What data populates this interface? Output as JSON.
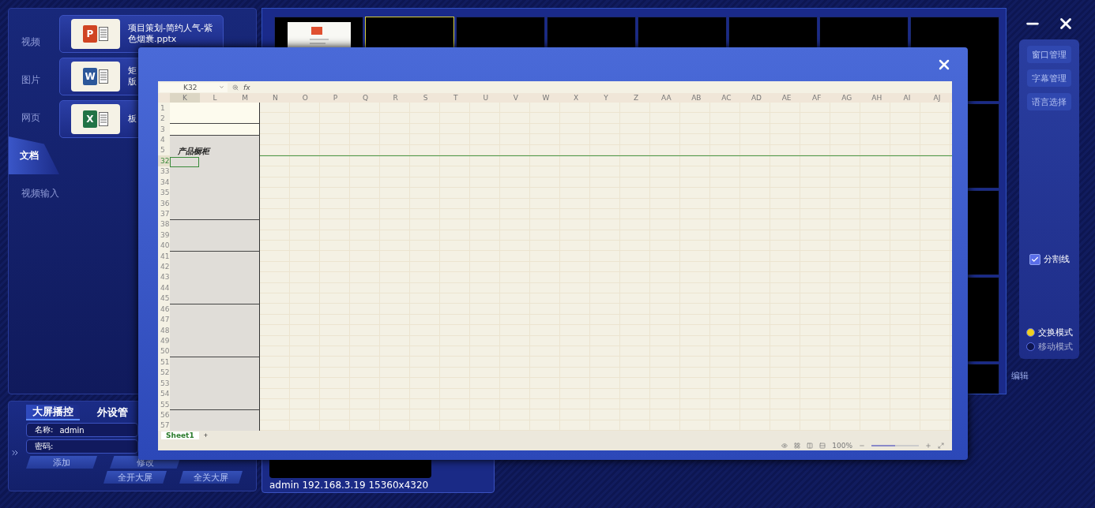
{
  "sidebar": {
    "items": [
      {
        "label": "视频",
        "selected": false
      },
      {
        "label": "图片",
        "selected": false
      },
      {
        "label": "网页",
        "selected": false
      },
      {
        "label": "文档",
        "selected": true
      },
      {
        "label": "视频输入",
        "selected": false
      }
    ]
  },
  "files": [
    {
      "kind": "ppt",
      "letter": "P",
      "lines": [
        "项目策划-简约人气-紫",
        "色烟囊.pptx"
      ]
    },
    {
      "kind": "word",
      "letter": "W",
      "lines": [
        "矩",
        "版"
      ]
    },
    {
      "kind": "excel",
      "letter": "X",
      "lines": [
        "板"
      ]
    }
  ],
  "video_wall": {
    "tiles": [
      {
        "kind": "document",
        "selected": false
      },
      {
        "kind": "empty",
        "selected": true
      },
      {
        "kind": "empty",
        "selected": false
      },
      {
        "kind": "empty",
        "selected": false
      },
      {
        "kind": "empty",
        "selected": false
      },
      {
        "kind": "empty",
        "selected": false
      },
      {
        "kind": "empty",
        "selected": false
      },
      {
        "kind": "empty",
        "selected": false
      }
    ]
  },
  "control_panel": {
    "buttons": [
      "窗口管理",
      "字幕管理",
      "语言选择"
    ],
    "divider": {
      "label": "分割线",
      "checked": true
    },
    "modes": [
      {
        "label": "交换模式",
        "selected": true
      },
      {
        "label": "移动模式",
        "selected": false
      }
    ],
    "footer": "编辑"
  },
  "account_panel": {
    "tabs": [
      {
        "label": "大屏播控",
        "selected": true
      },
      {
        "label": "外设管",
        "selected": false
      }
    ],
    "fields": [
      {
        "label": "名称:",
        "value": "admin"
      },
      {
        "label": "密码:"
      }
    ],
    "buttons": [
      "添加",
      "修改"
    ],
    "screen_buttons": [
      "全开大屏",
      "全关大屏"
    ]
  },
  "preview": {
    "status": "admin  192.168.3.19 15360x4320"
  },
  "sheet": {
    "name_box": "K32",
    "formula_label": "fx",
    "columns": [
      {
        "label": "K",
        "selected": true
      },
      {
        "label": "L",
        "selected": false
      },
      {
        "label": "M",
        "selected": false
      },
      {
        "label": "N",
        "selected": false
      },
      {
        "label": "O",
        "selected": false
      },
      {
        "label": "P",
        "selected": false
      },
      {
        "label": "Q",
        "selected": false
      },
      {
        "label": "R",
        "selected": false
      },
      {
        "label": "S",
        "selected": false
      },
      {
        "label": "T",
        "selected": false
      },
      {
        "label": "U",
        "selected": false
      },
      {
        "label": "V",
        "selected": false
      },
      {
        "label": "W",
        "selected": false
      },
      {
        "label": "X",
        "selected": false
      },
      {
        "label": "Y",
        "selected": false
      },
      {
        "label": "Z",
        "selected": false
      },
      {
        "label": "AA",
        "selected": false
      },
      {
        "label": "AB",
        "selected": false
      },
      {
        "label": "AC",
        "selected": false
      },
      {
        "label": "AD",
        "selected": false
      },
      {
        "label": "AE",
        "selected": false
      },
      {
        "label": "AF",
        "selected": false
      },
      {
        "label": "AG",
        "selected": false
      },
      {
        "label": "AH",
        "selected": false
      },
      {
        "label": "AI",
        "selected": false
      },
      {
        "label": "AJ",
        "selected": false
      }
    ],
    "rows": [
      {
        "label": "1",
        "selected": false
      },
      {
        "label": "2",
        "selected": false
      },
      {
        "label": "3",
        "selected": false
      },
      {
        "label": "4",
        "selected": false
      },
      {
        "label": "5",
        "selected": false
      },
      {
        "label": "32",
        "selected": true
      },
      {
        "label": "33",
        "selected": false
      },
      {
        "label": "34",
        "selected": false
      },
      {
        "label": "35",
        "selected": false
      },
      {
        "label": "36",
        "selected": false
      },
      {
        "label": "37",
        "selected": false
      },
      {
        "label": "38",
        "selected": false
      },
      {
        "label": "39",
        "selected": false
      },
      {
        "label": "40",
        "selected": false
      },
      {
        "label": "41",
        "selected": false
      },
      {
        "label": "42",
        "selected": false
      },
      {
        "label": "43",
        "selected": false
      },
      {
        "label": "44",
        "selected": false
      },
      {
        "label": "45",
        "selected": false
      },
      {
        "label": "46",
        "selected": false
      },
      {
        "label": "47",
        "selected": false
      },
      {
        "label": "48",
        "selected": false
      },
      {
        "label": "49",
        "selected": false
      },
      {
        "label": "50",
        "selected": false
      },
      {
        "label": "51",
        "selected": false
      },
      {
        "label": "52",
        "selected": false
      },
      {
        "label": "53",
        "selected": false
      },
      {
        "label": "54",
        "selected": false
      },
      {
        "label": "55",
        "selected": false
      },
      {
        "label": "56",
        "selected": false
      },
      {
        "label": "57",
        "selected": false
      }
    ],
    "frozen_label": "产品橱柜",
    "sheet_tabs": [
      {
        "label": "Sheet1",
        "selected": true
      }
    ],
    "add_sheet": "+",
    "zoom": "100%",
    "zoom_slider": {
      "level": 0.5
    }
  }
}
